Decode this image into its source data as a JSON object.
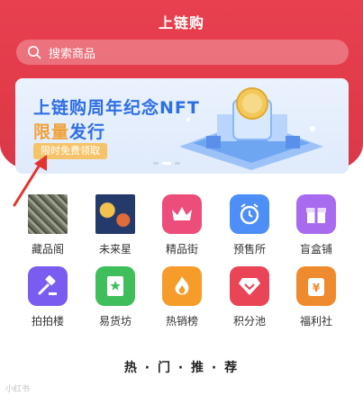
{
  "header": {
    "title": "上链购"
  },
  "search": {
    "placeholder": "搜索商品"
  },
  "banner": {
    "line1": "上链购周年纪念NFT",
    "line2_highlight": "限量",
    "line2_rest": "发行",
    "tag": "限时免费领取",
    "active_slide": 2,
    "slide_count": 3
  },
  "grid": {
    "items": [
      {
        "label": "藏品阁",
        "icon": "collection-thumbnail"
      },
      {
        "label": "未来星",
        "icon": "future-star-thumbnail"
      },
      {
        "label": "精品街",
        "icon": "crown-icon",
        "color": "#ec4d7a"
      },
      {
        "label": "预售所",
        "icon": "alarm-clock-icon",
        "color": "#4e8ef7"
      },
      {
        "label": "盲盒铺",
        "icon": "gift-box-icon",
        "color": "#a86bf0"
      },
      {
        "label": "拍拍楼",
        "icon": "gavel-icon",
        "color": "#7b5cf0"
      },
      {
        "label": "易货坊",
        "icon": "tag-star-icon",
        "color": "#3fbf5b"
      },
      {
        "label": "热销榜",
        "icon": "flame-icon",
        "color": "#f59c2b"
      },
      {
        "label": "积分池",
        "icon": "gem-icon",
        "color": "#ea4457"
      },
      {
        "label": "福利社",
        "icon": "yen-bag-icon",
        "color": "#f08a2f"
      }
    ]
  },
  "section": {
    "hot_title": "热 · 门 · 推 · 荐"
  },
  "watermark": "小红书"
}
